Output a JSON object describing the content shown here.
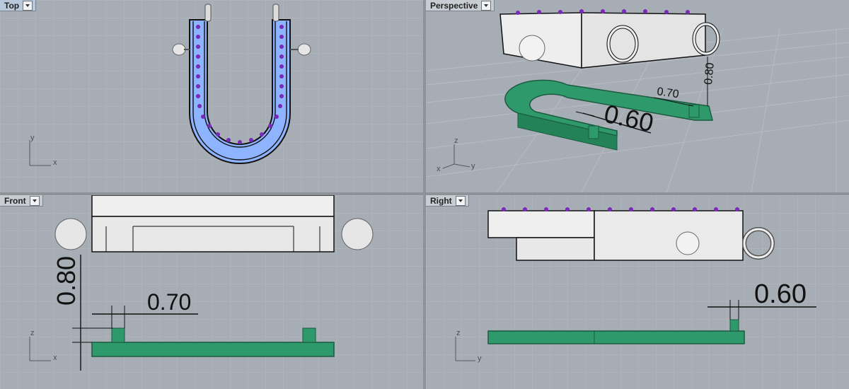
{
  "viewports": [
    {
      "name": "Top",
      "active": true
    },
    {
      "name": "Perspective",
      "active": false
    },
    {
      "name": "Front",
      "active": false
    },
    {
      "name": "Right",
      "active": false
    }
  ],
  "axes": {
    "top": [
      "y",
      "x"
    ],
    "perspective": [
      "z",
      "x",
      "y"
    ],
    "front": [
      "z",
      "x"
    ],
    "right": [
      "z",
      "y"
    ]
  },
  "dimensions": {
    "perspective": [
      "0.60",
      "0.70",
      "0.80"
    ],
    "front": [
      "0.80",
      "0.70"
    ],
    "right": [
      "0.60"
    ]
  },
  "icons": [
    "dropdown-arrow-icon"
  ],
  "colors": {
    "viewport_bg": "#a7adb4",
    "grid_line": "#b9bec4",
    "model_green": "#2e9a6c",
    "model_white": "#f0f0f0",
    "gem_purple": "#7a2ab8",
    "gem_blue": "#8fb4ff"
  }
}
